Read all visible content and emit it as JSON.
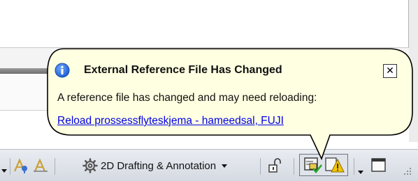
{
  "notification": {
    "title": "External Reference File Has Changed",
    "message": "A reference file has changed and may need reloading:",
    "link": "Reload prossessflyteskjema - hameedsal, FUJI",
    "close_glyph": "✕",
    "icon": "info-icon"
  },
  "statusbar": {
    "workspace_label": "2D Drafting & Annotation",
    "icons": [
      "annotation-scale-icon",
      "annotation-visibility-icon",
      "workspace-gear-icon",
      "lock-icon",
      "xref-changed-icon",
      "warning-triangle-icon",
      "clean-screen-icon",
      "resize-grip-icon"
    ]
  },
  "colors": {
    "balloon_fill": "#ffffe1",
    "balloon_border": "#000000",
    "link": "#0000e6",
    "info_blue": "#1f5fd1",
    "warning_yellow": "#f4c400"
  }
}
